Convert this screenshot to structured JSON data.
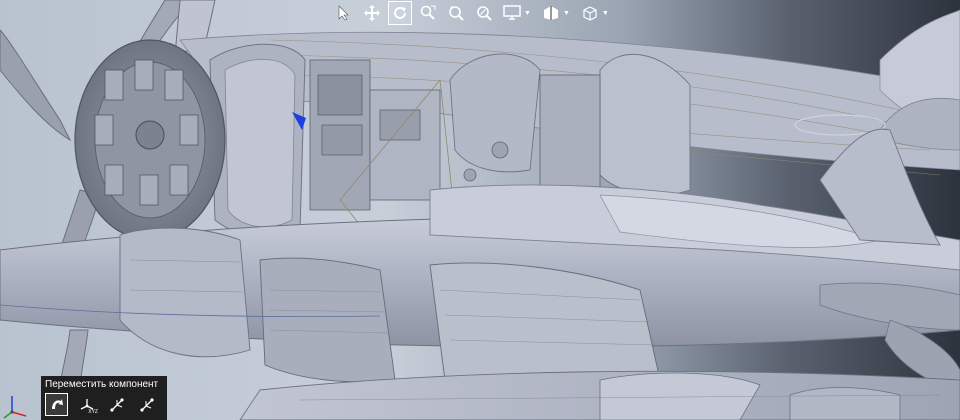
{
  "toolbar": {
    "tools": [
      {
        "icon": "select-arrow-icon",
        "active": false
      },
      {
        "icon": "pan-icon",
        "active": false
      },
      {
        "icon": "rotate-icon",
        "active": true
      },
      {
        "icon": "zoom-area-icon",
        "active": false
      },
      {
        "icon": "zoom-in-out-icon",
        "active": false
      },
      {
        "icon": "zoom-fit-icon",
        "active": false
      },
      {
        "icon": "display-mode-icon",
        "active": false,
        "has_menu": true
      },
      {
        "icon": "section-view-icon",
        "active": false,
        "has_menu": true
      },
      {
        "icon": "view-cube-icon",
        "active": false,
        "has_menu": true
      }
    ]
  },
  "move_panel": {
    "title": "Переместить компонент",
    "buttons": [
      {
        "icon": "free-move-icon",
        "active": true
      },
      {
        "icon": "move-xyz-icon",
        "label": "XYZ",
        "active": false
      },
      {
        "icon": "move-along-entity-icon",
        "active": false
      },
      {
        "icon": "move-by-delta-icon",
        "active": false
      }
    ]
  },
  "triad": {
    "axes": [
      "x",
      "y",
      "z"
    ],
    "colors": {
      "x": "#e02020",
      "y": "#20a020",
      "z": "#2040e0"
    }
  },
  "colors": {
    "model": "#b4b9c8",
    "edge": "#555a66",
    "highlight": "#1f3fe0",
    "panel_bg": "#1f1f1f"
  }
}
